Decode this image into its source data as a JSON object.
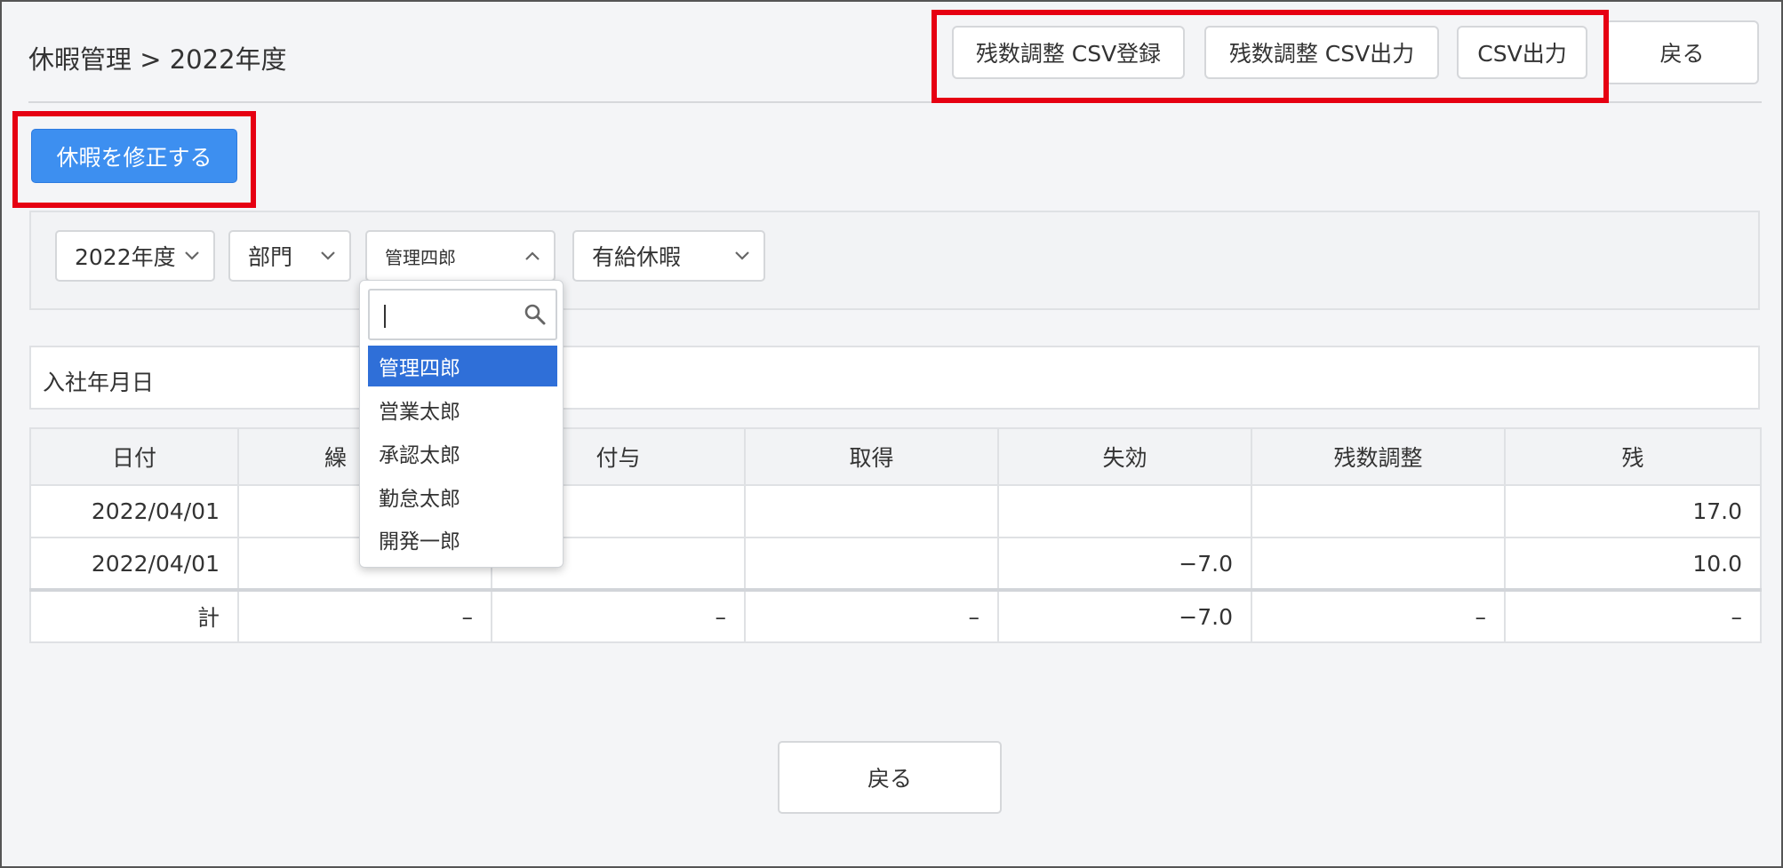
{
  "header": {
    "title": "休暇管理 > 2022年度",
    "buttons": {
      "csv_register": "残数調整 CSV登録",
      "csv_output_adjust": "残数調整 CSV出力",
      "csv_output": "CSV出力",
      "back": "戻る"
    }
  },
  "edit_button": "休暇を修正する",
  "filters": {
    "year": "2022年度",
    "department": "部門",
    "user": "管理四郎",
    "leave_type": "有給休暇"
  },
  "user_dropdown": {
    "search_value": "",
    "options": [
      "管理四郎",
      "営業太郎",
      "承認太郎",
      "勤怠太郎",
      "開発一郎"
    ],
    "selected_index": 0
  },
  "hire_date_label": "入社年月日",
  "table": {
    "columns": [
      "日付",
      "繰",
      "付与",
      "取得",
      "失効",
      "残数調整",
      "残"
    ],
    "rows": [
      [
        "2022/04/01",
        "",
        "",
        "",
        "",
        "",
        "17.0"
      ],
      [
        "2022/04/01",
        "",
        "",
        "",
        "−7.0",
        "",
        "10.0"
      ]
    ],
    "total": [
      "計",
      "–",
      "–",
      "–",
      "−7.0",
      "–",
      "–"
    ]
  },
  "footer": {
    "back": "戻る"
  },
  "colors": {
    "highlight": "#e60012",
    "primary": "#3d8ff0",
    "selected": "#2f6fd8"
  }
}
